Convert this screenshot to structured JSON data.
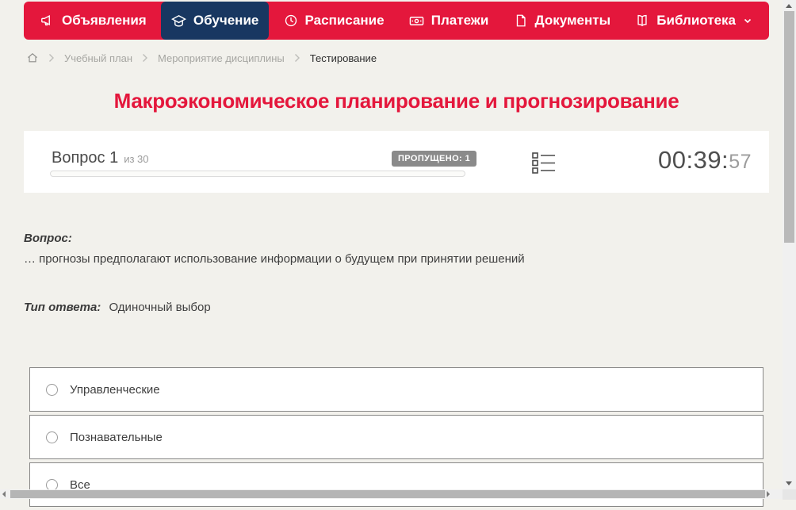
{
  "nav": {
    "items": [
      {
        "label": "Объявления",
        "icon": "megaphone-icon",
        "active": false
      },
      {
        "label": "Обучение",
        "icon": "graduation-cap-icon",
        "active": true
      },
      {
        "label": "Расписание",
        "icon": "clock-icon",
        "active": false
      },
      {
        "label": "Платежи",
        "icon": "cash-icon",
        "active": false
      },
      {
        "label": "Документы",
        "icon": "document-icon",
        "active": false
      },
      {
        "label": "Библиотека",
        "icon": "book-icon",
        "has_dropdown": true,
        "dropdown_icon": "chevron-down-icon",
        "active": false
      }
    ]
  },
  "breadcrumb": {
    "home_icon": "home-icon",
    "items": [
      "Учебный план",
      "Мероприятие дисциплины",
      "Тестирование"
    ]
  },
  "page": {
    "title": "Макроэкономическое планирование и прогнозирование"
  },
  "question_header": {
    "question_label": "Вопрос 1",
    "of_label": "из 30",
    "skipped_badge": "ПРОПУЩЕНО: 1",
    "progress_percent": 0,
    "list_icon": "question-list-icon",
    "timer": {
      "main": "00:39:",
      "seconds": "57"
    }
  },
  "question": {
    "label": "Вопрос:",
    "text": "… прогнозы предполагают использование информации о будущем при принятии решений",
    "answer_type_label": "Тип ответа:",
    "answer_type_value": "Одиночный выбор"
  },
  "options": [
    {
      "label": "Управленческие",
      "selected": false
    },
    {
      "label": "Познавательные",
      "selected": false
    },
    {
      "label": "Все",
      "selected": false
    }
  ],
  "colors": {
    "nav_red": "#e4173c",
    "active_navy": "#183761",
    "page_bg": "#f2f1ec",
    "title_red": "#e4173c",
    "badge_gray": "#8a8a8a",
    "text_dark": "#3f3f3f",
    "timer_dark": "#4f4f4f",
    "timer_light": "#9c9c9c"
  }
}
